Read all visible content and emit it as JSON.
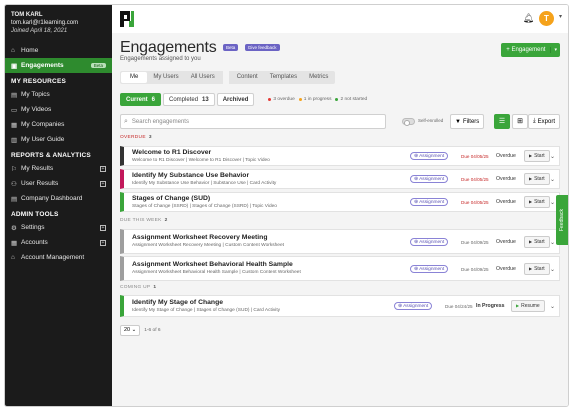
{
  "user": {
    "name": "TOM KARL",
    "email": "tom.karl@r1learning.com",
    "joined": "Joined April 18, 2021"
  },
  "sidebar": {
    "top_items": [
      {
        "label": "Home",
        "icon": "home-icon"
      },
      {
        "label": "Engagements",
        "icon": "engagements-icon",
        "badge": "Beta",
        "active": true
      }
    ],
    "my_resources": {
      "heading": "MY RESOURCES",
      "items": [
        {
          "label": "My Topics",
          "icon": "topics-icon"
        },
        {
          "label": "My Videos",
          "icon": "video-icon"
        },
        {
          "label": "My Companies",
          "icon": "company-icon"
        },
        {
          "label": "My User Guide",
          "icon": "guide-icon"
        }
      ]
    },
    "reports": {
      "heading": "REPORTS & ANALYTICS",
      "items": [
        {
          "label": "My Results",
          "icon": "results-icon",
          "expand": "+"
        },
        {
          "label": "User Results",
          "icon": "user-results-icon",
          "expand": "+"
        },
        {
          "label": "Company Dashboard",
          "icon": "dashboard-icon"
        }
      ]
    },
    "admin": {
      "heading": "ADMIN TOOLS",
      "items": [
        {
          "label": "Settings",
          "icon": "settings-icon",
          "expand": "+"
        },
        {
          "label": "Accounts",
          "icon": "accounts-icon",
          "expand": "+"
        },
        {
          "label": "Account Management",
          "icon": "account-management-icon"
        }
      ]
    }
  },
  "header": {
    "title": "Engagements",
    "pill_beta": "Beta",
    "pill_feedback": "Give feedback",
    "subtitle": "Engagements assigned to you",
    "add_button": "+ Engagement",
    "avatar_initial": "T"
  },
  "tabs": {
    "group1": [
      "Me",
      "My Users",
      "All Users"
    ],
    "group2": [
      "Content",
      "Templates",
      "Metrics"
    ]
  },
  "statuses": [
    {
      "label": "Current",
      "count": "6",
      "selected": true
    },
    {
      "label": "Completed",
      "count": "13"
    },
    {
      "label": "Archived",
      "count": ""
    }
  ],
  "legend": [
    {
      "text": "3 overdue",
      "color": "#e53935"
    },
    {
      "text": "1 in progress",
      "color": "#f5a21b"
    },
    {
      "text": "2 not started",
      "color": "#3aa53a"
    }
  ],
  "search": {
    "placeholder": "Search engagements"
  },
  "toolbar": {
    "self_enrolled": "Self-enrolled",
    "filters": "Filters",
    "export": "Export"
  },
  "groups": {
    "overdue": {
      "label": "OVERDUE",
      "count": "3"
    },
    "this_week": {
      "label": "DUE THIS WEEK",
      "count": "2"
    },
    "coming_up": {
      "label": "COMING UP",
      "count": "1"
    }
  },
  "cards": [
    {
      "title": "Welcome to R1 Discover",
      "sub": "Welcome to R1 Discover | Welcome to R1 Discover | Topic Video",
      "badge": "Assignment",
      "due": "Due 04/05/25",
      "status": "Overdue",
      "action": "Start",
      "color": "#333333"
    },
    {
      "title": "Identify My Substance Use Behavior",
      "sub": "Identify My Substance Use Behavior | Substance Use | Card Activity",
      "badge": "Assignment",
      "due": "Due 04/05/25",
      "status": "Overdue",
      "action": "Start",
      "color": "#c2185b"
    },
    {
      "title": "Stages of Change (SUD)",
      "sub": "Stages of Change (SSRD) | Stages of Change (SSRD) | Topic Video",
      "badge": "Assignment",
      "due": "Due 04/05/25",
      "status": "Overdue",
      "action": "Start",
      "color": "#3aa53a"
    },
    {
      "title": "Assignment Worksheet Recovery Meeting",
      "sub": "Assignment Worksheet Recovery Meeting | Custom Content  Worksheet",
      "badge": "Assignment",
      "due": "Due 04/09/25",
      "status": "Overdue",
      "action": "Start",
      "color": "#9e9e9e"
    },
    {
      "title": "Assignment Worksheet Behavioral Health Sample",
      "sub": "Assignment Worksheet Behavioral Health Sample | Custom Content  Worksheet",
      "badge": "Assignment",
      "due": "Due 04/09/25",
      "status": "Overdue",
      "action": "Start",
      "color": "#9e9e9e"
    },
    {
      "title": "Identify My Stage of Change",
      "sub": "Identify My Stage of Change | Stages of Change (SUD) | Card Activity",
      "badge": "Assignment",
      "due": "Due 04/24/25",
      "status": "In Progress",
      "action": "Resume",
      "color": "#3aa53a"
    }
  ],
  "feedback_tab": "Feedback",
  "pager": {
    "size": "20",
    "info": "1-6 of 6"
  }
}
